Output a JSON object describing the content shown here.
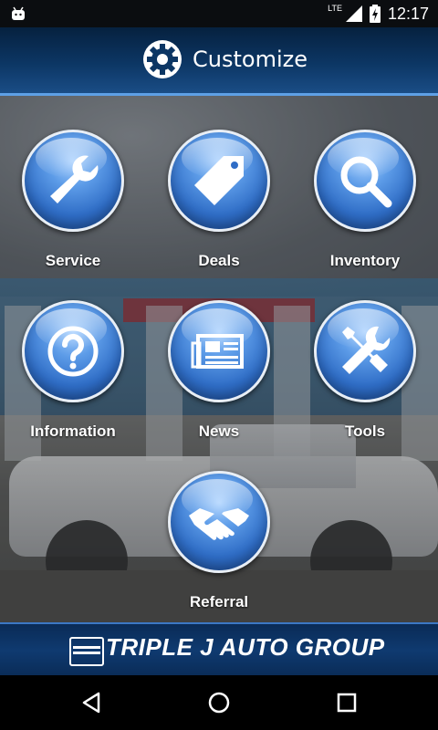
{
  "status_bar": {
    "network": "LTE",
    "time": "12:17"
  },
  "header": {
    "title": "Customize",
    "icon": "gear-icon"
  },
  "menu": [
    {
      "label": "Service",
      "icon": "wrench-icon"
    },
    {
      "label": "Deals",
      "icon": "tag-icon"
    },
    {
      "label": "Inventory",
      "icon": "magnifier-icon"
    },
    {
      "label": "Information",
      "icon": "question-icon"
    },
    {
      "label": "News",
      "icon": "newspaper-icon"
    },
    {
      "label": "Tools",
      "icon": "tools-icon"
    },
    {
      "label": "Referral",
      "icon": "handshake-icon"
    }
  ],
  "footer": {
    "brand": "TRIPLE J AUTO GROUP"
  },
  "colors": {
    "header_bg": "#0c3664",
    "orb_blue": "#2f6dc6",
    "accent": "#5ea0e6"
  }
}
